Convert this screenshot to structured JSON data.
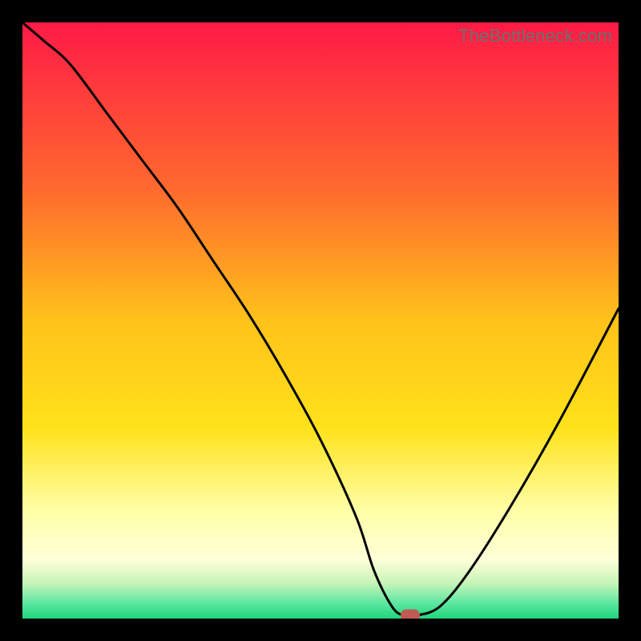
{
  "watermark": "TheBottleneck.com",
  "colors": {
    "red": "#ff1a46",
    "orange": "#ffa61a",
    "yellow": "#ffe21a",
    "pale_yellow": "#ffffbf",
    "pale_green": "#c8f5b8",
    "green": "#1fd67a",
    "curve": "#000000",
    "marker": "#c05a54",
    "frame": "#000000",
    "wm_text": "#6e6e6e"
  },
  "chart_data": {
    "type": "line",
    "title": "",
    "xlabel": "",
    "ylabel": "",
    "xlim": [
      0,
      100
    ],
    "ylim": [
      0,
      100
    ],
    "legend": false,
    "grid": false,
    "series": [
      {
        "name": "bottleneck-curve",
        "x": [
          0,
          3.5,
          8,
          14,
          20,
          26,
          32,
          38,
          44,
          50,
          56,
          59,
          62,
          64,
          66,
          70,
          75,
          82,
          90,
          100
        ],
        "values": [
          100,
          97,
          93,
          85,
          77,
          69,
          60,
          51,
          41,
          30,
          17,
          8,
          2,
          0.5,
          0.5,
          2,
          8,
          19,
          33,
          52
        ]
      }
    ],
    "marker": {
      "x": 65,
      "y": 0.5
    },
    "gradient_stops": [
      {
        "pos": 0,
        "color": "#ff1a46"
      },
      {
        "pos": 0.28,
        "color": "#ff6a2e"
      },
      {
        "pos": 0.5,
        "color": "#ffc21a"
      },
      {
        "pos": 0.68,
        "color": "#ffe21a"
      },
      {
        "pos": 0.82,
        "color": "#ffffa8"
      },
      {
        "pos": 0.9,
        "color": "#ffffd8"
      },
      {
        "pos": 0.94,
        "color": "#c8f5b8"
      },
      {
        "pos": 0.975,
        "color": "#5ae6a0"
      },
      {
        "pos": 1.0,
        "color": "#1fd67a"
      }
    ]
  }
}
